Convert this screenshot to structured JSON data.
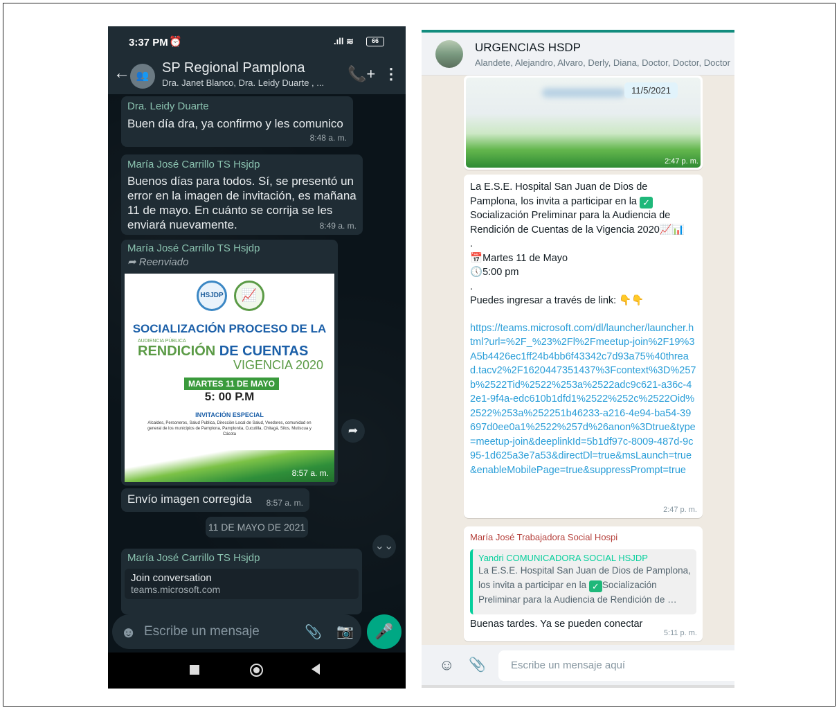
{
  "left": {
    "status": {
      "time": "3:37 PM",
      "alarm": "⏰",
      "signal": ".ıll ≋",
      "battery": "66"
    },
    "header": {
      "back": "←",
      "group_icon": "👥",
      "name": "SP Regional Pamplona",
      "members": "Dra. Janet Blanco, Dra. Leidy Duarte , ...",
      "call_icon": "📞+",
      "more_icon": "⋮"
    },
    "messages": [
      {
        "sender": "Dra. Leidy Duarte",
        "text": "Buen día dra, ya confirmo y les comunico",
        "time": "8:48 a. m."
      },
      {
        "sender": "María José Carrillo TS Hsjdp",
        "text": "Buenos días para todos. Sí, se presentó un error en la imagen de invitación, es mañana 11 de mayo. En cuánto se corrija se les enviará nuevamente.",
        "time": "8:49 a. m."
      },
      {
        "sender": "María José Carrillo TS Hsjdp",
        "forwarded": "➦ Reenviado",
        "time": "8:57 a. m."
      },
      {
        "text": "Envío imagen corregida",
        "time": "8:57 a. m."
      }
    ],
    "invitation": {
      "logo1": "HSJDP",
      "logo2": "📈",
      "title": "SOCIALIZACIÓN PROCESO DE LA",
      "small": "AUDIENCIA PÚBLICA",
      "big1": "RENDICIÓN",
      "big2": " DE CUENTAS",
      "vig": "VIGENCIA 2020",
      "date": "MARTES 11 DE MAYO",
      "hour": "5: 00 P.M",
      "special": "INVITACIÓN ESPECIAL",
      "desc": "Alcaldes, Personeros, Salud Publica, Dirección Local de Salud, Veedores, comunidad en general de los municipios de Pamplona, Pamplonita, Cucutilla, Chitagá, Silos, Mutiscua y Cácota"
    },
    "date_chip": "11 DE MAYO DE 2021",
    "last": {
      "sender": "María José Carrillo TS Hsjdp",
      "join_title": "Join conversation",
      "join_url": "teams.microsoft.com"
    },
    "input": {
      "emoji_icon": "☻",
      "placeholder": "Escribe un mensaje",
      "clip_icon": "📎",
      "camera_icon": "📷",
      "mic_icon": "🎤"
    },
    "scroll_icon": "⌄⌄",
    "forward_icon": "➦"
  },
  "right": {
    "header": {
      "name": "URGENCIAS HSDP",
      "members": "Alandete, Alejandro, Alvaro, Derly, Diana, Doctor, Doctor, Doctor"
    },
    "image_msg": {
      "date": "11/5/2021",
      "time": "2:47 p. m."
    },
    "main_msg": {
      "line1": "La E.S.E. Hospital San Juan de Dios de Pamplona, los invita a participar en la",
      "line2": "Socialización Preliminar para la Audiencia de Rendición de Cuentas de la Vigencia 2020",
      "chart_emoji": "📈📊",
      "dot1": ".",
      "cal": "📅",
      "date": "Martes 11 de Mayo",
      "clock": "🕔",
      "hour": "5:00 pm",
      "dot2": ".",
      "cta": "Puedes ingresar a través de link:",
      "hands": "👇👇",
      "link": "https://teams.microsoft.com/dl/launcher/launcher.html?url=%2F_%23%2Fl%2Fmeetup-join%2F19%3A5b4426ec1ff24b4bb6f43342c7d93a75%40thread.tacv2%2F1620447351437%3Fcontext%3D%257b%2522Tid%2522%253a%2522adc9c621-a36c-42e1-9f4a-edc610b1dfd1%2522%252c%2522Oid%2522%253a%252251b46233-a216-4e94-ba54-39697d0ee0a1%2522%257d%26anon%3Dtrue&type=meetup-join&deeplinkId=5b1df97c-8009-487d-9c95-1d625a3e7a53&directDl=true&msLaunch=true&enableMobilePage=true&suppressPrompt=true",
      "time": "2:47 p. m."
    },
    "reply_msg": {
      "sender": "María José Trabajadora Social Hospi",
      "quoted_sender": "Yandri COMUNICADORA SOCIAL HSJDP",
      "quoted_text1": "La E.S.E. Hospital San Juan de Dios de Pamplona, los invita a participar en la",
      "quoted_text2": "Socialización Preliminar para la Audiencia de Rendición de …",
      "text": "Buenas tardes. Ya se pueden conectar",
      "time": "5:11 p. m."
    },
    "input": {
      "emoji_icon": "☺",
      "clip_icon": "📎",
      "placeholder": "Escribe un mensaje aquí"
    }
  }
}
